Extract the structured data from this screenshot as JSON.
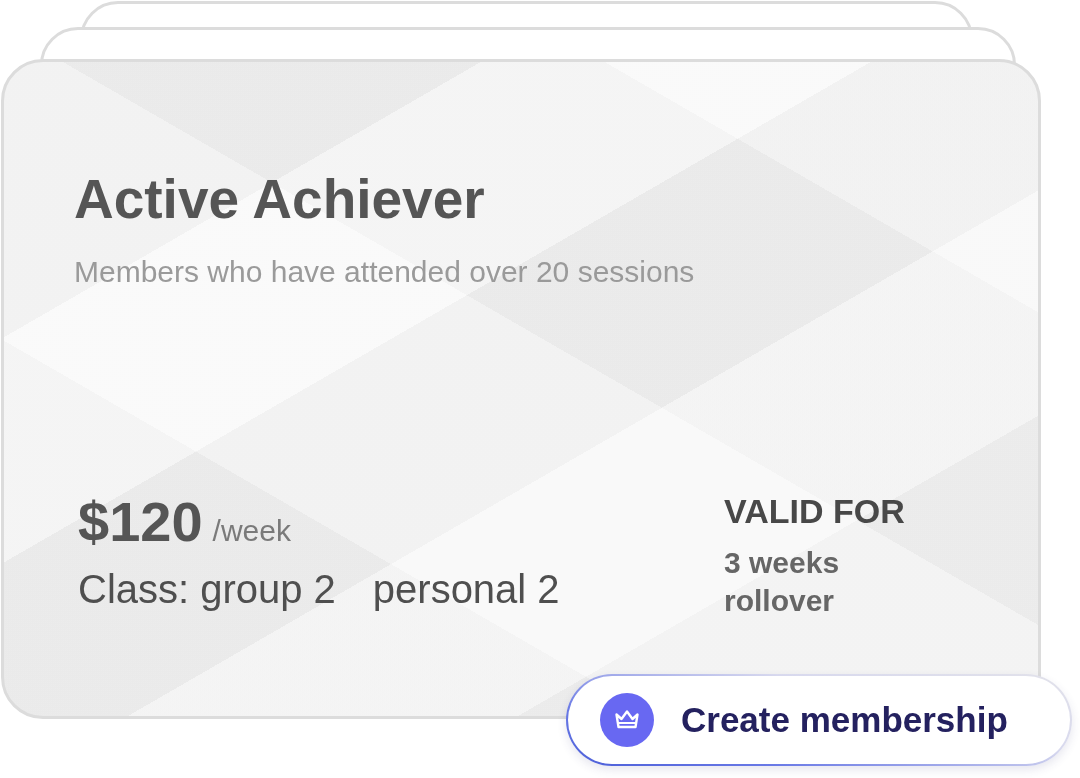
{
  "membership_card": {
    "title": "Active Achiever",
    "description": "Members who have attended over 20 sessions",
    "price": {
      "amount": "$120",
      "period": "/week"
    },
    "classes": {
      "label": "Class:",
      "items": [
        "group 2",
        "personal 2"
      ]
    },
    "validity": {
      "label": "VALID FOR",
      "value": "3 weeks rollover"
    }
  },
  "action_button": {
    "label": "Create membership"
  }
}
